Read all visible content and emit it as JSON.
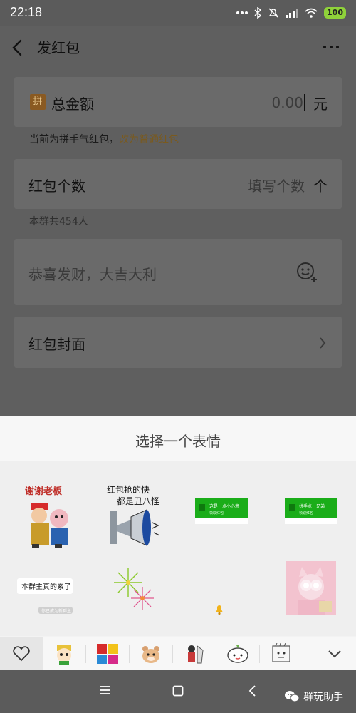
{
  "status_bar": {
    "time": "22:18",
    "battery": "100"
  },
  "header": {
    "title": "发红包"
  },
  "amount": {
    "badge": "拼",
    "label": "总金额",
    "value": "0.00",
    "unit": "元"
  },
  "hint": {
    "current": "当前为拼手气红包，",
    "link": "改为普通红包"
  },
  "count": {
    "label": "红包个数",
    "placeholder": "填写个数",
    "unit": "个"
  },
  "members_text": "本群共454人",
  "message": {
    "placeholder": "恭喜发财，大吉大利"
  },
  "cover": {
    "label": "红包封面"
  },
  "sheet": {
    "title": "选择一个表情",
    "stickers": {
      "s1_text": "谢谢老板",
      "s2_line1": "红包抢的快",
      "s2_line2": "都是丑八怪",
      "s3_text": "这是一点小心意",
      "s3_sub": "领取红包",
      "s4_text": "拼手点，兄弟",
      "s4_sub": "领取红包",
      "s5_text": "本群主真的累了",
      "s5_sub": "你已成为新群主"
    },
    "tabs": [
      "favorites",
      "pack-1",
      "pack-2",
      "pack-3",
      "pack-4",
      "pack-5",
      "pack-6"
    ]
  },
  "watermark": "群玩助手",
  "colors": {
    "overlay": "#5f5f5f",
    "card": "#6a6a6a",
    "link": "#7a5a1e",
    "badge": "#8a5a22",
    "wechat_green": "#1aad19"
  }
}
